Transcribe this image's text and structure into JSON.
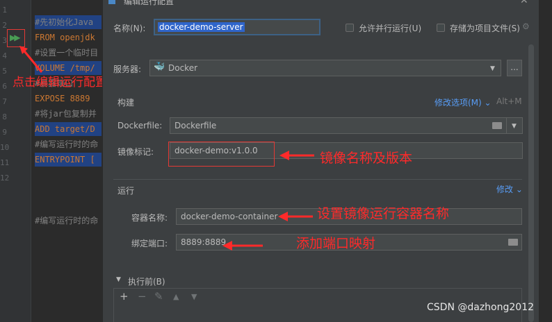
{
  "editor": {
    "line_numbers": [
      "1",
      "2",
      "3",
      "4",
      "5",
      "6",
      "7",
      "8",
      "9",
      "10",
      "11",
      "12"
    ],
    "code_lines": [
      {
        "text": "#先初始化Java",
        "kind": "comment",
        "highlight": true
      },
      {
        "text": "FROM openjdk",
        "kind": "kw",
        "highlight": false
      },
      {
        "text": "#设置一个临时目",
        "kind": "comment",
        "highlight": false
      },
      {
        "text": "VOLUME /tmp/",
        "kind": "kw",
        "highlight": true
      },
      {
        "text": "#暴露端口",
        "kind": "comment",
        "highlight": false
      },
      {
        "text": "EXPOSE 8889",
        "kind": "kw",
        "highlight": false
      },
      {
        "text": "#将jar包复制并",
        "kind": "comment",
        "highlight": false
      },
      {
        "text": "ADD target/D",
        "kind": "kw",
        "highlight": true
      },
      {
        "text": "#编写运行时的命",
        "kind": "comment",
        "highlight": false
      },
      {
        "text": "ENTRYPOINT [",
        "kind": "kw",
        "highlight": true
      },
      {
        "text": "#编写运行时的命",
        "kind": "comment",
        "highlight": false
      }
    ]
  },
  "annotations": {
    "run_config": "点击编辑运行配置",
    "image_name": "镜像名称及版本",
    "container_name": "设置镜像运行容器名称",
    "port_mapping": "添加端口映射"
  },
  "dialog": {
    "title": "编辑运行配置",
    "name_label": "名称(N):",
    "name_value": "docker-demo-server",
    "parallel_label": "允许并行运行(U)",
    "store_label": "存储为项目文件(S)",
    "server_label": "服务器:",
    "server_value": "Docker",
    "more_button": "...",
    "build_section": "构建",
    "modify_options": "修改选项(M)",
    "modify_shortcut": "Alt+M",
    "dockerfile_label": "Dockerfile:",
    "dockerfile_value": "Dockerfile",
    "image_tag_label": "镜像标记:",
    "image_tag_value": "docker-demo:v1.0.0",
    "run_section": "运行",
    "modify_link": "修改",
    "container_label": "容器名称:",
    "container_value": "docker-demo-container",
    "port_label": "绑定端口:",
    "port_value": "8889:8889",
    "before_launch": "执行前(B)"
  },
  "watermark": "CSDN @dazhong2012",
  "colors": {
    "accent": "#589df6",
    "annotation": "#ff2a2a",
    "selection": "#2f65ca"
  }
}
